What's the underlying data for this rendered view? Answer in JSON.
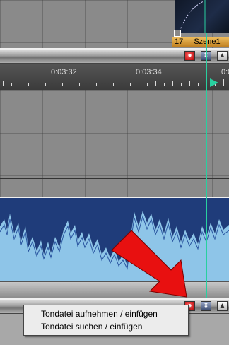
{
  "top_clip": {
    "label": "Szene1",
    "number": "17"
  },
  "timeline": {
    "timecodes": [
      "0:03:32",
      "0:03:34",
      "0:0"
    ]
  },
  "track_buttons": {
    "record": "●",
    "swap": "⇕",
    "eject": "▲"
  },
  "context_menu": {
    "items": [
      {
        "label": "Tondatei aufnehmen / einfügen"
      },
      {
        "label": "Tondatei suchen / einfügen"
      }
    ]
  },
  "colors": {
    "track_bg": "#8a8a8a",
    "audio_top": "#1f3c7a",
    "audio_wave": "#8ec5e8",
    "playhead": "#28d0a0",
    "arrow": "#e81010"
  }
}
